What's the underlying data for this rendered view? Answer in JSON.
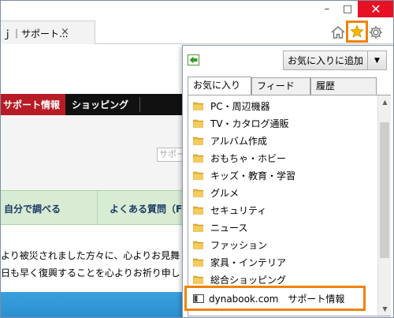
{
  "browser": {
    "tab_title": "ｊ｜サポート...",
    "tab_close": "×",
    "window_controls": {
      "minimize": "–",
      "maximize": "□",
      "close": "✕"
    },
    "icons": [
      "home-icon",
      "star-icon",
      "gear-icon"
    ],
    "accent_color": "#f08300"
  },
  "page": {
    "nav": {
      "support": "サポート情報",
      "shopping": "ショッピング"
    },
    "search_placeholder": "サポー",
    "menu": {
      "self_check": "自分で調べる",
      "faq": "よくある質問（F"
    },
    "notice_line1": "より被災されました方々に、心よりお見舞",
    "notice_line2": "日も早く復興することを心よりお祈り申し",
    "colors": {
      "nav_red": "#b71c26",
      "menu_green": "#d8ecd4",
      "band_blue": "#2a8fce"
    }
  },
  "favorites": {
    "add_button": "お気に入りに追加",
    "tabs": [
      "お気に入り",
      "フィード",
      "履歴"
    ],
    "folders": [
      "PC・周辺機器",
      "TV・カタログ通販",
      "アルバム作成",
      "おもちゃ・ホビー",
      "キッズ・教育・学習",
      "グルメ",
      "セキュリティ",
      "ニュース",
      "ファッション",
      "家具・インテリア",
      "総合ショッピング"
    ],
    "link": "dynabook.com　サポート情報"
  }
}
